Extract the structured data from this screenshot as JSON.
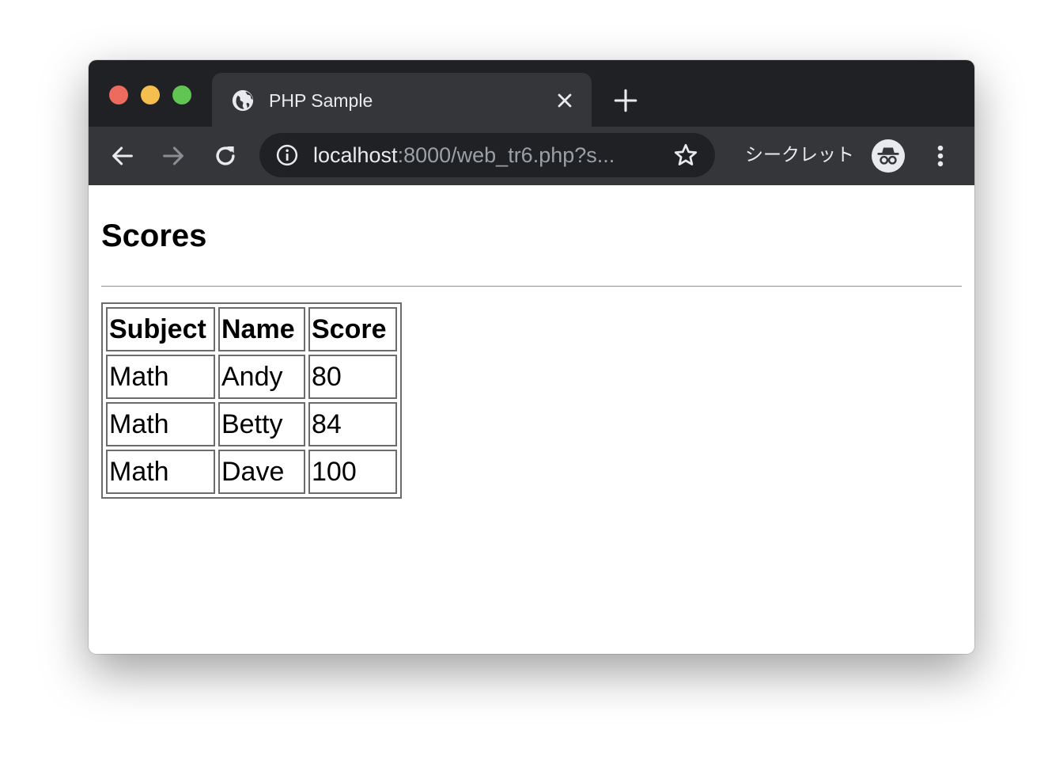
{
  "browser": {
    "tab": {
      "title": "PHP Sample",
      "favicon": "globe-icon"
    },
    "toolbar": {
      "url_host": "localhost",
      "url_rest": ":8000/web_tr6.php?s...",
      "incognito_label": "シークレット"
    },
    "colors": {
      "tab_strip": "#202124",
      "toolbar": "#35363a",
      "omnibox": "#202124",
      "close_light": "#ed6a5e",
      "minimize_light": "#f5bf4f",
      "maximize_light": "#61c554"
    }
  },
  "page": {
    "title": "Scores",
    "table": {
      "headers": [
        "Subject",
        "Name",
        "Score"
      ],
      "rows": [
        [
          "Math",
          "Andy",
          "80"
        ],
        [
          "Math",
          "Betty",
          "84"
        ],
        [
          "Math",
          "Dave",
          "100"
        ]
      ]
    }
  }
}
